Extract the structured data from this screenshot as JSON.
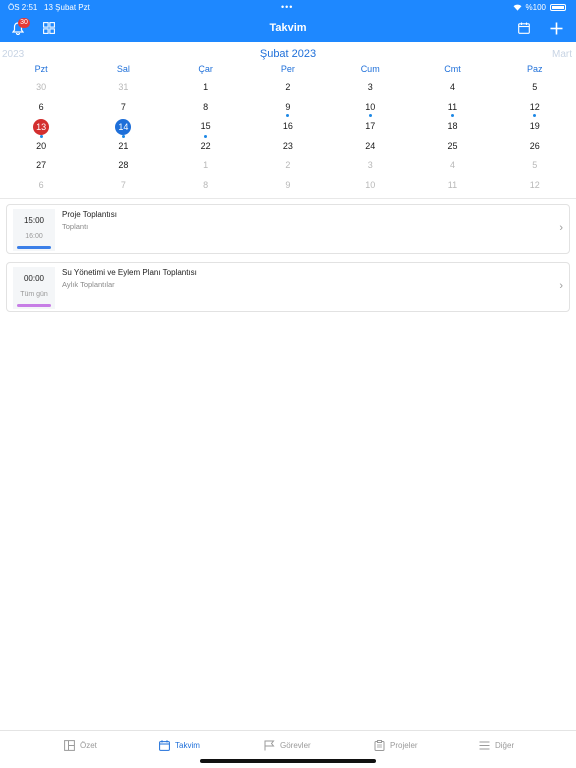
{
  "status": {
    "time": "ÖS 2:51",
    "date": "13 Şubat Pzt",
    "battery": "%100"
  },
  "nav": {
    "title": "Takvim",
    "badge": "30"
  },
  "calendar": {
    "prev_month": "2023",
    "current_month": "Şubat 2023",
    "next_month": "Mart",
    "weekdays": [
      "Pzt",
      "Sal",
      "Çar",
      "Per",
      "Cum",
      "Cmt",
      "Paz"
    ],
    "weeks": [
      [
        {
          "d": "30",
          "m": true
        },
        {
          "d": "31",
          "m": true
        },
        {
          "d": "1"
        },
        {
          "d": "2"
        },
        {
          "d": "3"
        },
        {
          "d": "4"
        },
        {
          "d": "5"
        }
      ],
      [
        {
          "d": "6"
        },
        {
          "d": "7"
        },
        {
          "d": "8"
        },
        {
          "d": "9",
          "dot": true
        },
        {
          "d": "10",
          "dot": true
        },
        {
          "d": "11",
          "dot": true
        },
        {
          "d": "12",
          "dot": true
        }
      ],
      [
        {
          "d": "13",
          "sel": "red",
          "dot": true
        },
        {
          "d": "14",
          "sel": "blue",
          "dot": true
        },
        {
          "d": "15",
          "dot": true
        },
        {
          "d": "16"
        },
        {
          "d": "17"
        },
        {
          "d": "18"
        },
        {
          "d": "19"
        }
      ],
      [
        {
          "d": "20"
        },
        {
          "d": "21"
        },
        {
          "d": "22"
        },
        {
          "d": "23"
        },
        {
          "d": "24"
        },
        {
          "d": "25"
        },
        {
          "d": "26"
        }
      ],
      [
        {
          "d": "27"
        },
        {
          "d": "28"
        },
        {
          "d": "1",
          "m": true
        },
        {
          "d": "2",
          "m": true
        },
        {
          "d": "3",
          "m": true
        },
        {
          "d": "4",
          "m": true
        },
        {
          "d": "5",
          "m": true
        }
      ],
      [
        {
          "d": "6",
          "m": true
        },
        {
          "d": "7",
          "m": true
        },
        {
          "d": "8",
          "m": true
        },
        {
          "d": "9",
          "m": true
        },
        {
          "d": "10",
          "m": true
        },
        {
          "d": "11",
          "m": true
        },
        {
          "d": "12",
          "m": true
        }
      ]
    ]
  },
  "events": [
    {
      "start": "15:00",
      "end": "16:00",
      "title": "Proje Toplantısı",
      "subtitle": "Toplantı",
      "color": "#3b7fe8"
    },
    {
      "start": "00:00",
      "end": "Tüm gün",
      "title": "Su Yönetimi ve Eylem Planı Toplantısı",
      "subtitle": "Aylık Toplantılar",
      "color": "#c77ee6"
    }
  ],
  "tabs": {
    "summary": "Özet",
    "calendar": "Takvim",
    "tasks": "Görevler",
    "projects": "Projeler",
    "more": "Diğer"
  },
  "colors": {
    "accent": "#1e88ff",
    "today": "#d32f2f",
    "selected": "#1e6fd9"
  }
}
